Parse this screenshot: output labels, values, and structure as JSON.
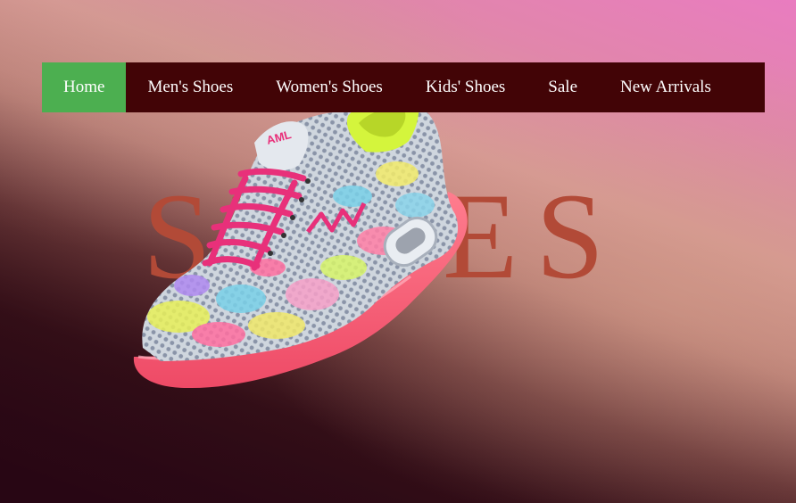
{
  "nav": {
    "items": [
      {
        "label": "Home",
        "active": true
      },
      {
        "label": "Men's Shoes",
        "active": false
      },
      {
        "label": "Women's Shoes",
        "active": false
      },
      {
        "label": "Kids' Shoes",
        "active": false
      },
      {
        "label": "Sale",
        "active": false
      },
      {
        "label": "New Arrivals",
        "active": false
      }
    ]
  },
  "hero": {
    "title": "SHOES"
  },
  "colors": {
    "nav_bg": "#420406",
    "nav_active": "#4caf50",
    "hero_text": "#b24a37",
    "shoe_sole": "#f5617a",
    "shoe_laces": "#e8307a",
    "shoe_collar": "#d4f53c"
  },
  "icons": {
    "shoe": "sneaker-image"
  }
}
